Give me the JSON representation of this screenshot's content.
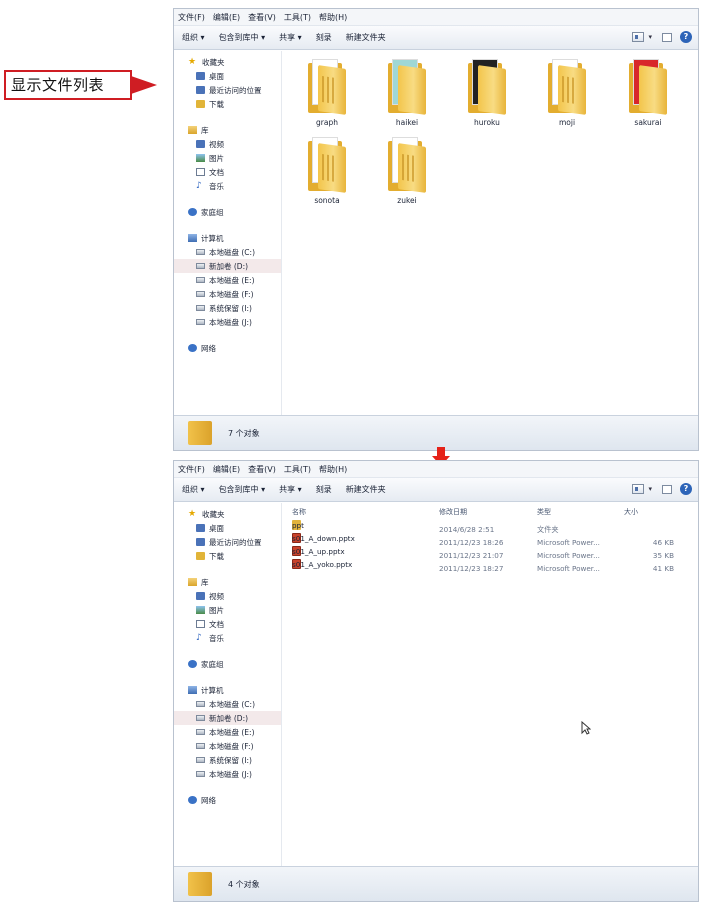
{
  "callout": {
    "text": "显示文件列表",
    "color": "#cf1d23"
  },
  "menu": [
    "文件(F)",
    "编辑(E)",
    "查看(V)",
    "工具(T)",
    "帮助(H)"
  ],
  "toolbar": [
    "组织 ▾",
    "包含到库中 ▾",
    "共享 ▾",
    "刻录",
    "新建文件夹"
  ],
  "nav": {
    "favorites": "收藏夹",
    "favorite_items": [
      "桌面",
      "最近访问的位置",
      "下载"
    ],
    "libraries": "库",
    "library_items": [
      "视频",
      "图片",
      "文档",
      "音乐"
    ],
    "homegroup": "家庭组",
    "computer": "计算机",
    "drives": [
      "本地磁盘 (C:)",
      "新加卷 (D:)",
      "本地磁盘 (E:)",
      "本地磁盘 (F:)",
      "系统保留 (I:)",
      "本地磁盘 (J:)"
    ],
    "network": "网络"
  },
  "before": {
    "folders": [
      "graph",
      "haikei",
      "huroku",
      "moji",
      "sakurai",
      "sonota",
      "zukei"
    ],
    "status": "7 个对象"
  },
  "after": {
    "columns": {
      "name": "名称",
      "date": "修改日期",
      "type": "类型",
      "size": "大小"
    },
    "files": [
      {
        "name": "ppt",
        "date": "2014/6/28 2:51",
        "type": "文件夹",
        "size": "",
        "icon": "folder-icon"
      },
      {
        "name": "s01_A_down.pptx",
        "date": "2011/12/23 18:26",
        "type": "Microsoft Power...",
        "size": "46 KB",
        "icon": "pptx-icon"
      },
      {
        "name": "s01_A_up.pptx",
        "date": "2011/12/23 21:07",
        "type": "Microsoft Power...",
        "size": "35 KB",
        "icon": "pptx-icon"
      },
      {
        "name": "s01_A_yoko.pptx",
        "date": "2011/12/23 18:27",
        "type": "Microsoft Power...",
        "size": "41 KB",
        "icon": "pptx-icon"
      }
    ],
    "status": "4 个对象"
  },
  "colors": {
    "arrow": "#e52219",
    "folder": "#e3ad2f",
    "window_border": "#b9c2cf"
  }
}
